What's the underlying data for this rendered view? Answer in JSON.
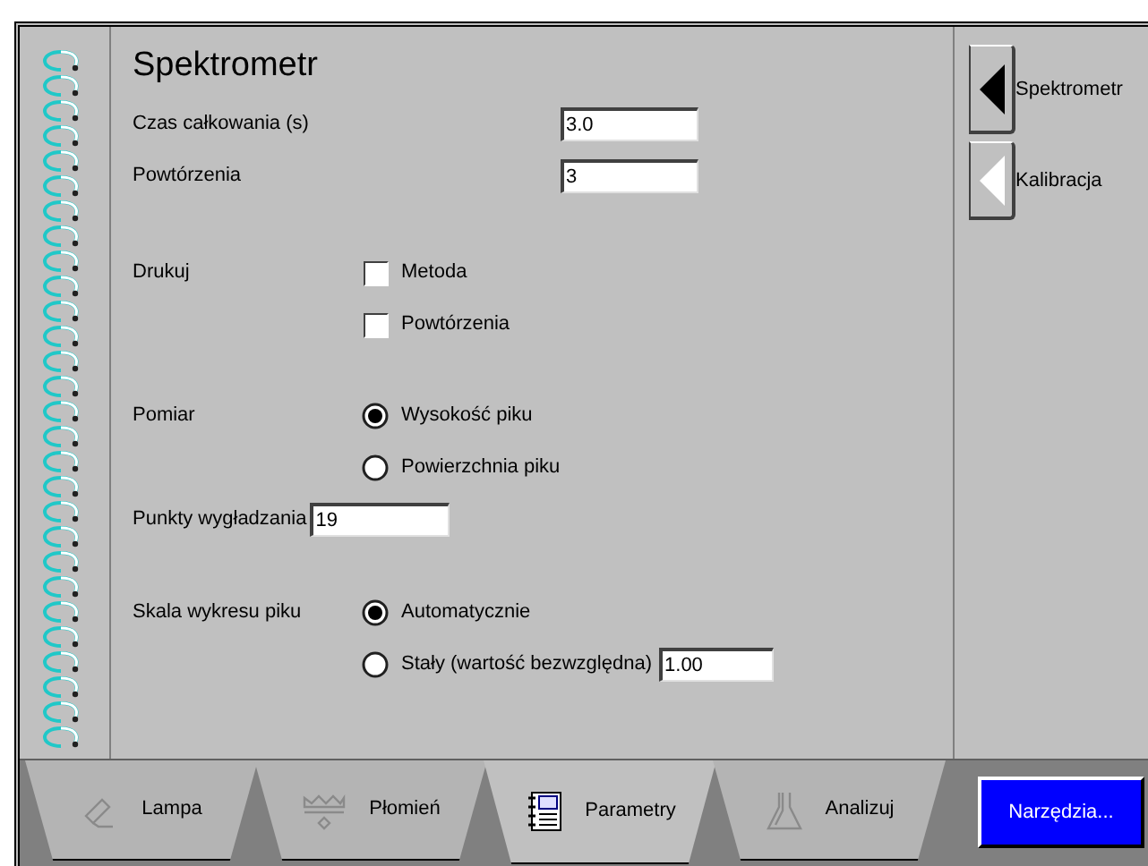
{
  "title": "Spektrometr",
  "fields": [
    {
      "label": "Czas całkowania (s)",
      "value": "3.0"
    },
    {
      "label": "Powtórzenia",
      "value": "3"
    }
  ],
  "print": {
    "label": "Drukuj",
    "options": [
      {
        "label": "Metoda",
        "checked": false
      },
      {
        "label": "Powtórzenia",
        "checked": false
      }
    ]
  },
  "measurement": {
    "label": "Pomiar",
    "options": [
      {
        "label": "Wysokość piku",
        "selected": true
      },
      {
        "label": "Powierzchnia piku",
        "selected": false
      }
    ]
  },
  "smoothing": {
    "label": "Punkty wygładzania",
    "value": "19"
  },
  "scale": {
    "label": "Skala wykresu piku",
    "options": [
      {
        "label": "Automatycznie",
        "selected": true
      },
      {
        "label": "Stały (wartość bezwzględna)",
        "selected": false,
        "value": "1.00"
      }
    ]
  },
  "side_nav": [
    {
      "label": "Spektrometr",
      "selected": true
    },
    {
      "label": "Kalibracja",
      "selected": false
    }
  ],
  "tabs": [
    {
      "label": "Lampa",
      "selected": false
    },
    {
      "label": "Płomień",
      "selected": false
    },
    {
      "label": "Parametry",
      "selected": true
    },
    {
      "label": "Analizuj",
      "selected": false
    }
  ],
  "tools_button": "Narzędzia..."
}
